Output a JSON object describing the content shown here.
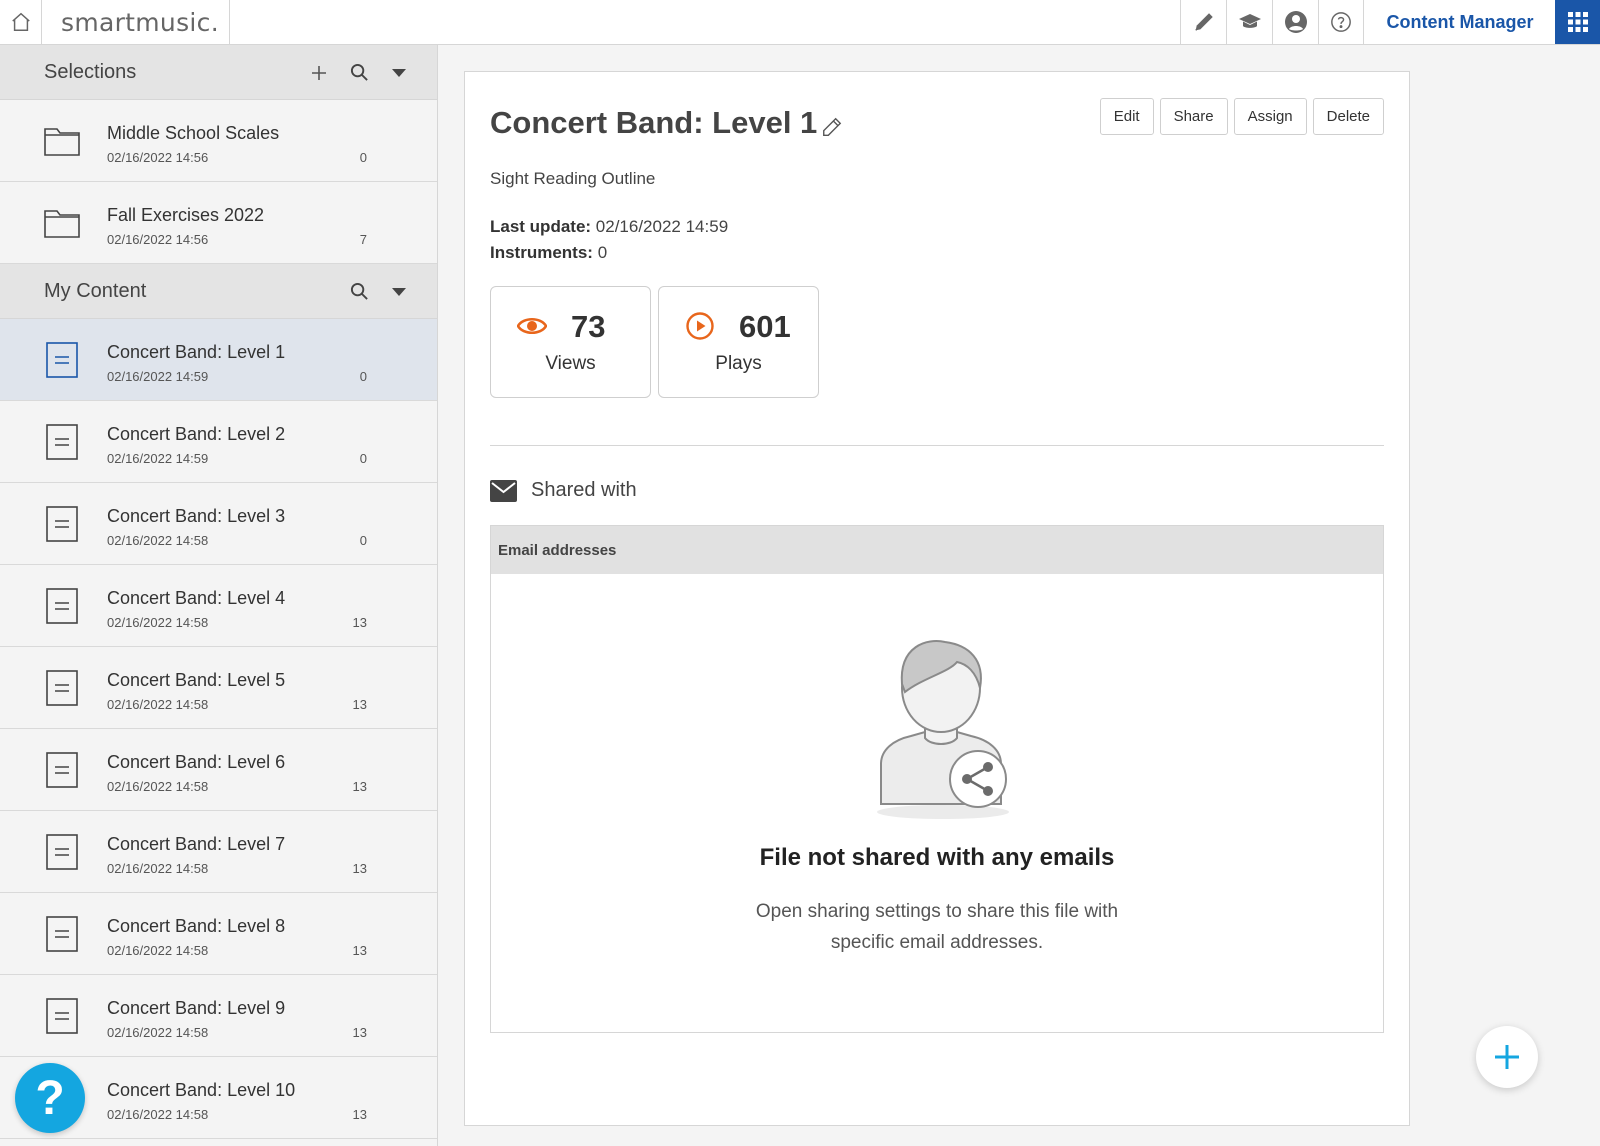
{
  "app": {
    "logo": "smartmusic.",
    "nav_title": "Content Manager"
  },
  "colors": {
    "brand_blue": "#1a56a8",
    "accent_orange": "#e8661c",
    "help_blue": "#14a6e0"
  },
  "icons": {
    "home": "home-icon",
    "compose": "pencil-icon",
    "classes": "graduation-cap-icon",
    "profile": "user-circle-icon",
    "help": "question-circle-icon",
    "apps": "grid-icon"
  },
  "sidebar": {
    "selections": {
      "title": "Selections",
      "items": [
        {
          "title": "Middle School Scales",
          "date": "02/16/2022 14:56",
          "count": "0",
          "type": "folder"
        },
        {
          "title": "Fall Exercises 2022",
          "date": "02/16/2022 14:56",
          "count": "7",
          "type": "folder"
        }
      ]
    },
    "my_content": {
      "title": "My Content",
      "items": [
        {
          "title": "Concert Band: Level 1",
          "date": "02/16/2022 14:59",
          "count": "0"
        },
        {
          "title": "Concert Band: Level 2",
          "date": "02/16/2022 14:59",
          "count": "0"
        },
        {
          "title": "Concert Band: Level 3",
          "date": "02/16/2022 14:58",
          "count": "0"
        },
        {
          "title": "Concert Band: Level 4",
          "date": "02/16/2022 14:58",
          "count": "13"
        },
        {
          "title": "Concert Band: Level 5",
          "date": "02/16/2022 14:58",
          "count": "13"
        },
        {
          "title": "Concert Band: Level 6",
          "date": "02/16/2022 14:58",
          "count": "13"
        },
        {
          "title": "Concert Band: Level 7",
          "date": "02/16/2022 14:58",
          "count": "13"
        },
        {
          "title": "Concert Band: Level 8",
          "date": "02/16/2022 14:58",
          "count": "13"
        },
        {
          "title": "Concert Band: Level 9",
          "date": "02/16/2022 14:58",
          "count": "13"
        },
        {
          "title": "Concert Band: Level 10",
          "date": "02/16/2022 14:58",
          "count": "13"
        }
      ]
    },
    "help_fab": "?"
  },
  "detail": {
    "title": "Concert Band: Level 1",
    "actions": {
      "edit": "Edit",
      "share": "Share",
      "assign": "Assign",
      "delete": "Delete"
    },
    "subtitle": "Sight Reading Outline",
    "last_update_label": "Last update:",
    "last_update_value": "02/16/2022 14:59",
    "instruments_label": "Instruments:",
    "instruments_value": "0",
    "stats": {
      "views_value": "73",
      "views_label": "Views",
      "plays_value": "601",
      "plays_label": "Plays"
    },
    "shared": {
      "title": "Shared with",
      "column": "Email addresses",
      "empty_title": "File not shared with any emails",
      "empty_desc_line1": "Open sharing settings to share this file with",
      "empty_desc_line2": "specific email addresses."
    }
  }
}
